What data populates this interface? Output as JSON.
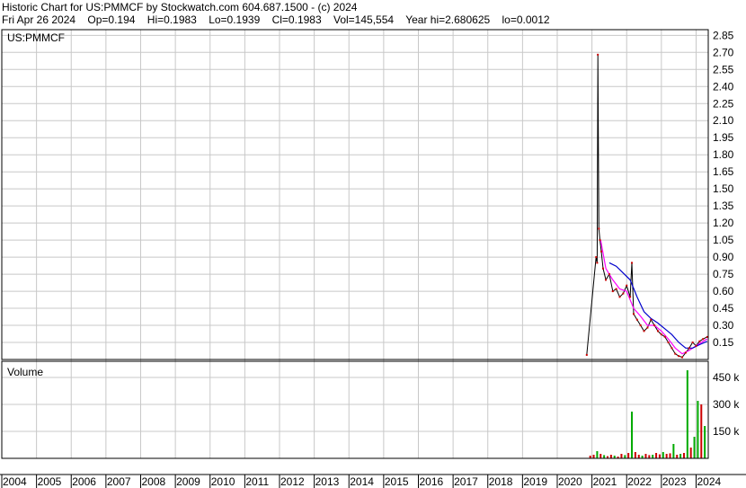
{
  "header": {
    "title_line": "Historic Chart for US:PMMCF by Stockwatch.com 604.687.1500 - (c) 2024",
    "date": "Fri Apr 26 2024",
    "open": "Op=0.194",
    "high": "Hi=0.1983",
    "low": "Lo=0.1939",
    "close": "Cl=0.1983",
    "volume": "Vol=145,554",
    "year_hi": "Year hi=2.680625",
    "year_lo": "lo=0.0012"
  },
  "price_panel": {
    "symbol_label": "US:PMMCF"
  },
  "volume_panel": {
    "label": "Volume"
  },
  "colors": {
    "grid": "#c8c8c8",
    "price": "#000000",
    "price_up": "#cc0000",
    "ma_short": "#ff00ff",
    "ma_long": "#0000cc",
    "vol_up": "#00aa00",
    "vol_down": "#cc0000"
  },
  "chart_data": [
    {
      "type": "line",
      "title": "US:PMMCF",
      "ylim": [
        0,
        2.9
      ],
      "yticks": [
        "2.85",
        "2.70",
        "2.55",
        "2.40",
        "2.25",
        "2.10",
        "1.95",
        "1.80",
        "1.65",
        "1.50",
        "1.35",
        "1.20",
        "1.05",
        "0.90",
        "0.75",
        "0.60",
        "0.45",
        "0.30",
        "0.15"
      ],
      "xticks": [
        "2004",
        "2005",
        "2006",
        "2007",
        "2008",
        "2009",
        "2010",
        "2011",
        "2012",
        "2013",
        "2014",
        "2015",
        "2016",
        "2017",
        "2018",
        "2019",
        "2020",
        "2021",
        "2022",
        "2023",
        "2024"
      ],
      "series": [
        {
          "x": [
            2020.85,
            2021.12,
            2021.15,
            2021.17,
            2021.2,
            2021.23,
            2021.27,
            2021.32,
            2021.4,
            2021.5,
            2021.6,
            2021.7,
            2021.8,
            2021.9,
            2022.0,
            2022.1,
            2022.15,
            2022.2,
            2022.3,
            2022.4,
            2022.5,
            2022.6,
            2022.7,
            2022.8,
            2022.9,
            2023.0,
            2023.1,
            2023.2,
            2023.3,
            2023.4,
            2023.5,
            2023.6,
            2023.7,
            2023.8,
            2023.9,
            2024.0,
            2024.1,
            2024.2,
            2024.32
          ],
          "y": [
            0.04,
            0.9,
            0.85,
            2.68,
            1.15,
            1.05,
            0.95,
            0.8,
            0.7,
            0.75,
            0.6,
            0.62,
            0.55,
            0.58,
            0.65,
            0.55,
            0.85,
            0.4,
            0.35,
            0.3,
            0.25,
            0.28,
            0.35,
            0.3,
            0.25,
            0.22,
            0.2,
            0.15,
            0.1,
            0.05,
            0.03,
            0.02,
            0.06,
            0.1,
            0.15,
            0.12,
            0.16,
            0.18,
            0.1983
          ]
        },
        {
          "x": [
            2021.25,
            2021.4,
            2021.6,
            2021.8,
            2022.0,
            2022.2,
            2022.4,
            2022.6,
            2022.8,
            2023.0,
            2023.2,
            2023.4,
            2023.6,
            2023.8,
            2024.0,
            2024.2,
            2024.32
          ],
          "y": [
            1.05,
            0.8,
            0.7,
            0.62,
            0.6,
            0.45,
            0.38,
            0.3,
            0.3,
            0.25,
            0.18,
            0.1,
            0.05,
            0.08,
            0.12,
            0.16,
            0.18
          ]
        },
        {
          "x": [
            2021.5,
            2021.7,
            2021.9,
            2022.1,
            2022.3,
            2022.5,
            2022.7,
            2022.9,
            2023.1,
            2023.3,
            2023.5,
            2023.7,
            2023.9,
            2024.1,
            2024.32
          ],
          "y": [
            0.85,
            0.82,
            0.76,
            0.7,
            0.55,
            0.42,
            0.36,
            0.32,
            0.27,
            0.22,
            0.15,
            0.1,
            0.1,
            0.13,
            0.16
          ]
        }
      ]
    },
    {
      "type": "bar",
      "title": "Volume",
      "ylim": [
        0,
        540000
      ],
      "yticks": [
        "450 k",
        "300 k",
        "150 k"
      ],
      "x": [
        2020.95,
        2021.05,
        2021.15,
        2021.25,
        2021.35,
        2021.45,
        2021.55,
        2021.65,
        2021.75,
        2021.85,
        2021.95,
        2022.05,
        2022.15,
        2022.25,
        2022.35,
        2022.45,
        2022.55,
        2022.65,
        2022.75,
        2022.85,
        2022.95,
        2023.05,
        2023.15,
        2023.25,
        2023.35,
        2023.45,
        2023.55,
        2023.65,
        2023.75,
        2023.85,
        2023.95,
        2024.05,
        2024.15,
        2024.25
      ],
      "values": [
        15000,
        20000,
        40000,
        25000,
        18000,
        12000,
        20000,
        15000,
        10000,
        25000,
        18000,
        30000,
        260000,
        35000,
        20000,
        15000,
        25000,
        18000,
        20000,
        30000,
        22000,
        35000,
        25000,
        28000,
        80000,
        20000,
        25000,
        30000,
        490000,
        60000,
        120000,
        320000,
        300000,
        180000
      ],
      "up": [
        false,
        false,
        true,
        false,
        true,
        false,
        false,
        true,
        false,
        false,
        true,
        false,
        true,
        false,
        false,
        true,
        false,
        false,
        true,
        false,
        false,
        true,
        false,
        false,
        true,
        false,
        true,
        false,
        true,
        false,
        true,
        true,
        false,
        true
      ]
    }
  ]
}
